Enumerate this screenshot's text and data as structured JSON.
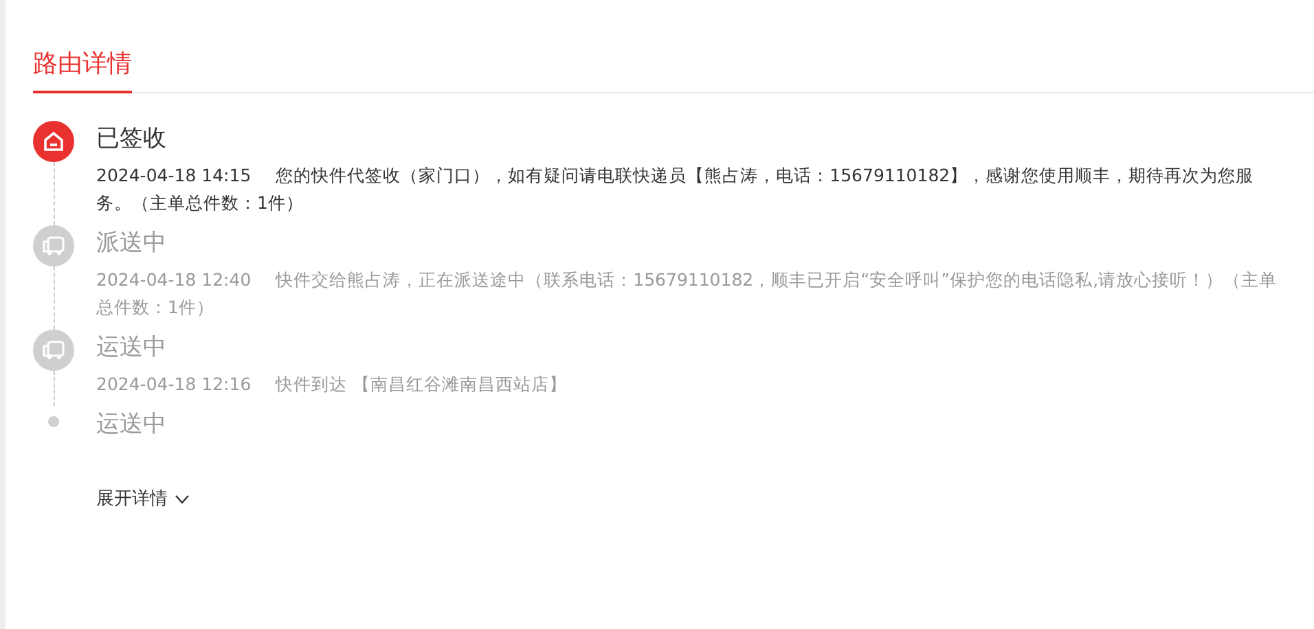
{
  "tabs": [
    {
      "label": "路由详情",
      "selected": true
    }
  ],
  "events": [
    {
      "kind": "signed",
      "status": "已签收",
      "time": "2024-04-18 14:15",
      "detail": "您的快件代签收（家门口），如有疑问请电联快递员【熊占涛，电话：15679110182】，感谢您使用顺丰，期待再次为您服务。（主单总件数：1件）",
      "current": true
    },
    {
      "kind": "truck",
      "status": "派送中",
      "time": "2024-04-18 12:40",
      "detail": "快件交给熊占涛，正在派送途中（联系电话：15679110182，顺丰已开启“安全呼叫”保护您的电话隐私,请放心接听！）（主单总件数：1件）",
      "current": false
    },
    {
      "kind": "truck",
      "status": "运送中",
      "time": "2024-04-18 12:16",
      "detail": "快件到达 【南昌红谷滩南昌西站店】",
      "current": false
    },
    {
      "kind": "dot",
      "status": "运送中",
      "current": false
    }
  ],
  "expand": {
    "label": "展开详情",
    "expanded": false
  }
}
